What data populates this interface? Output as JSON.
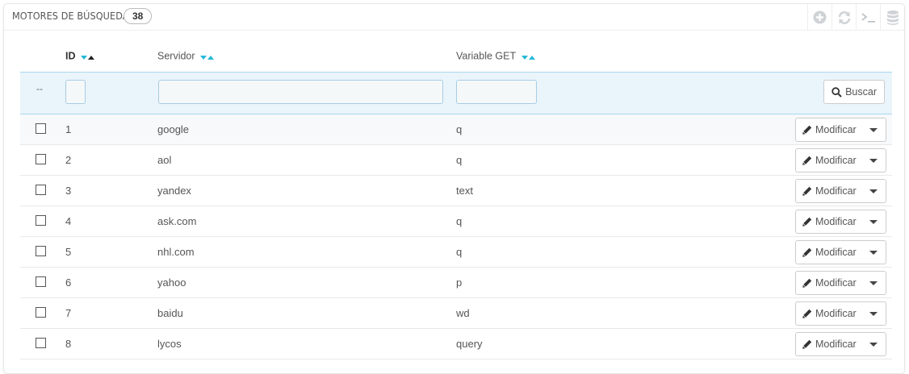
{
  "header": {
    "title": "MOTORES DE BÚSQUEDA",
    "count": "38",
    "toolbar": [
      {
        "icon": "add-icon"
      },
      {
        "icon": "refresh-icon"
      },
      {
        "icon": "sql-terminal-icon",
        "glyph": ">_"
      },
      {
        "icon": "database-icon"
      }
    ]
  },
  "table": {
    "columns": [
      {
        "label": "ID",
        "sort_active": "asc"
      },
      {
        "label": "Servidor"
      },
      {
        "label": "Variable GET"
      }
    ],
    "filters": {
      "dash": "--",
      "id_value": "",
      "server_value": "",
      "get_value": "",
      "search_label": "Buscar"
    },
    "rows": [
      {
        "id": "1",
        "server": "google",
        "get": "q"
      },
      {
        "id": "2",
        "server": "aol",
        "get": "q"
      },
      {
        "id": "3",
        "server": "yandex",
        "get": "text"
      },
      {
        "id": "4",
        "server": "ask.com",
        "get": "q"
      },
      {
        "id": "5",
        "server": "nhl.com",
        "get": "q"
      },
      {
        "id": "6",
        "server": "yahoo",
        "get": "p"
      },
      {
        "id": "7",
        "server": "baidu",
        "get": "wd"
      },
      {
        "id": "8",
        "server": "lycos",
        "get": "query"
      }
    ],
    "row_action_label": "Modificar"
  },
  "colors": {
    "accent": "#25b9d7",
    "filter_bg": "#eaf4fb",
    "filter_border": "#a9d8ee"
  }
}
